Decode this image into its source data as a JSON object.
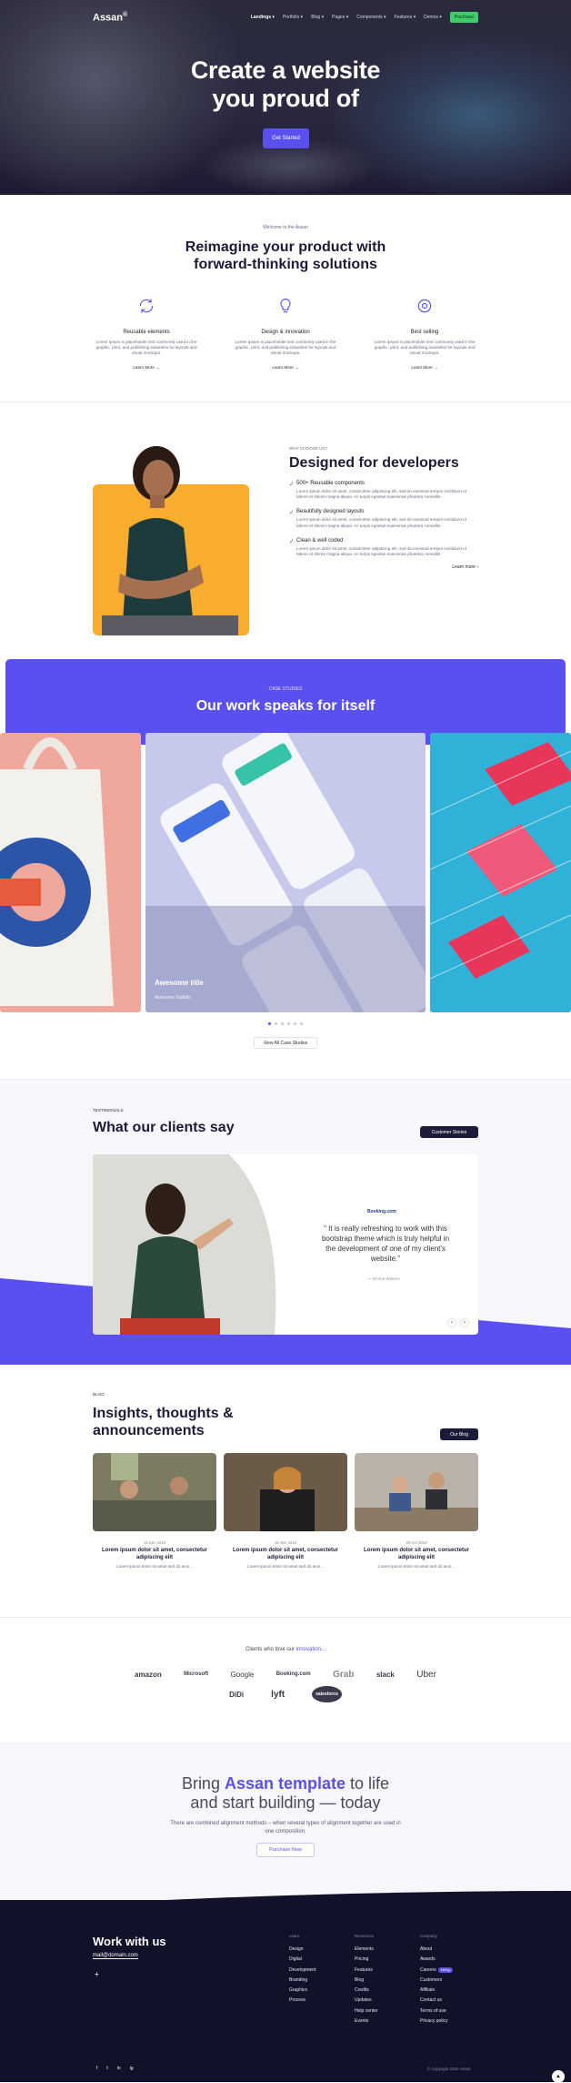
{
  "nav": {
    "logo": "Assan",
    "logo_sup": "®",
    "items": [
      "Landings",
      "Portfolio",
      "Blog",
      "Pages",
      "Components",
      "Features",
      "Demos"
    ],
    "purchase": "Purchase"
  },
  "hero": {
    "title": "Create a website you proud of",
    "cta": "Get Started"
  },
  "features": {
    "eyebrow": "Welcome to the Assan",
    "title": "Reimagine your product with forward-thinking solutions",
    "items": [
      {
        "icon": "refresh-icon",
        "title": "Reusable elements",
        "text": "Lorem Ipsum is placeholder text commonly used in the graphic, print, and publishing industries for layouts and visual mockups.",
        "link": "Learn More"
      },
      {
        "icon": "lightbulb-icon",
        "title": "Design & innovation",
        "text": "Lorem Ipsum is placeholder text commonly used in the graphic, print, and publishing industries for layouts and visual mockups.",
        "link": "Learn More"
      },
      {
        "icon": "support-icon",
        "title": "Best selling",
        "text": "Lorem Ipsum is placeholder text commonly used in the graphic, print, and publishing industries for layouts and visual mockups.",
        "link": "Learn More"
      }
    ]
  },
  "developers": {
    "eyebrow": "WHY CHOOSE US?",
    "title": "Designed for developers",
    "items": [
      {
        "title": "500+ Reusable components",
        "text": "Lorem ipsum dolor sit amet, consectetur adipiscing elit, sed do eiusmod tempor incididunt ut labore et dolore magna aliqua. Ac turpis egestas maecenas pharetra convallis."
      },
      {
        "title": "Beautifully designed layouts",
        "text": "Lorem ipsum dolor sit amet, consectetur adipiscing elit, sed do eiusmod tempor incididunt ut labore et dolore magna aliqua. Ac turpis egestas maecenas pharetra convallis."
      },
      {
        "title": "Clean & well coded",
        "text": "Lorem ipsum dolor sit amet, consectetur adipiscing elit, sed do eiusmod tempor incididunt ut labore et dolore magna aliqua. Ac turpis egestas maecenas pharetra convallis."
      }
    ],
    "more": "Learn more"
  },
  "cases": {
    "eyebrow": "CASE STUDIES",
    "title": "Our work speaks for itself",
    "caption_title": "Awesome title",
    "caption_sub": "Awesome Subtitle",
    "button": "View All Case Studies",
    "dots_total": 6,
    "dots_active": 1
  },
  "testimonials": {
    "eyebrow": "TESTIMONIALS",
    "title": "What our clients say",
    "button": "Customer Stories",
    "brand": "Booking.com",
    "quote": "\" It is really refreshing to work with this bootstrap theme which is truly helpful in the development of one of my client's website.\"",
    "author": "— Emma Watson"
  },
  "blog": {
    "eyebrow": "BLOG",
    "title": "Insights, thoughts & announcements",
    "button": "Our Blog",
    "posts": [
      {
        "date": "15 Dec 2019",
        "title": "Lorem ipsum dolor sit amet, consectetur adipiscing elit",
        "excerpt": "Lorem ipsum dolor sit amet sed do eius..."
      },
      {
        "date": "06 Nov 2019",
        "title": "Lorem ipsum dolor sit amet, consectetur adipiscing elit",
        "excerpt": "Lorem ipsum dolor sit amet sed do eius..."
      },
      {
        "date": "29 Oct 2019",
        "title": "Lorem ipsum dolor sit amet, consectetur adipiscing elit",
        "excerpt": "Lorem ipsum dolor sit amet sed do eius..."
      }
    ]
  },
  "clients": {
    "label": "Clients who love our",
    "label_em": "innovation...",
    "row1": [
      "amazon",
      "Microsoft",
      "Google",
      "Booking.com",
      "Grab",
      "slack",
      "Uber"
    ],
    "row2": [
      "DiDi",
      "lyft",
      "salesforce"
    ]
  },
  "cta": {
    "pre": "Bring ",
    "highlight": "Assan template",
    "post": " to life and start building — today",
    "text": "There are combined alignment methods – when several types of alignment together are used in one composition.",
    "button": "Purchase Now"
  },
  "footer": {
    "title": "Work with us",
    "email": "mail@domain.com",
    "plus": "+",
    "cols": [
      {
        "heading": "Learn",
        "links": [
          "Design",
          "Digital",
          "Development",
          "Branding",
          "Graphics",
          "Process"
        ]
      },
      {
        "heading": "Resources",
        "links": [
          "Elements",
          "Pricing",
          "Features",
          "Blog",
          "Credits",
          "Updates",
          "Help center",
          "Events"
        ]
      },
      {
        "heading": "Company",
        "links": [
          "About",
          "Awards",
          "Careers",
          "Customers",
          "Affiliate",
          "Contact us",
          "Terms of use",
          "Privacy policy"
        ]
      }
    ],
    "hiring": "Hiring",
    "social": [
      "f",
      "t",
      "in",
      "ig"
    ],
    "copyright": "© Copyright 2022 Assan"
  },
  "colors": {
    "accent": "#5a50f0",
    "dark": "#12112a",
    "green": "#3ecf6b",
    "orange": "#f9ad2f"
  }
}
